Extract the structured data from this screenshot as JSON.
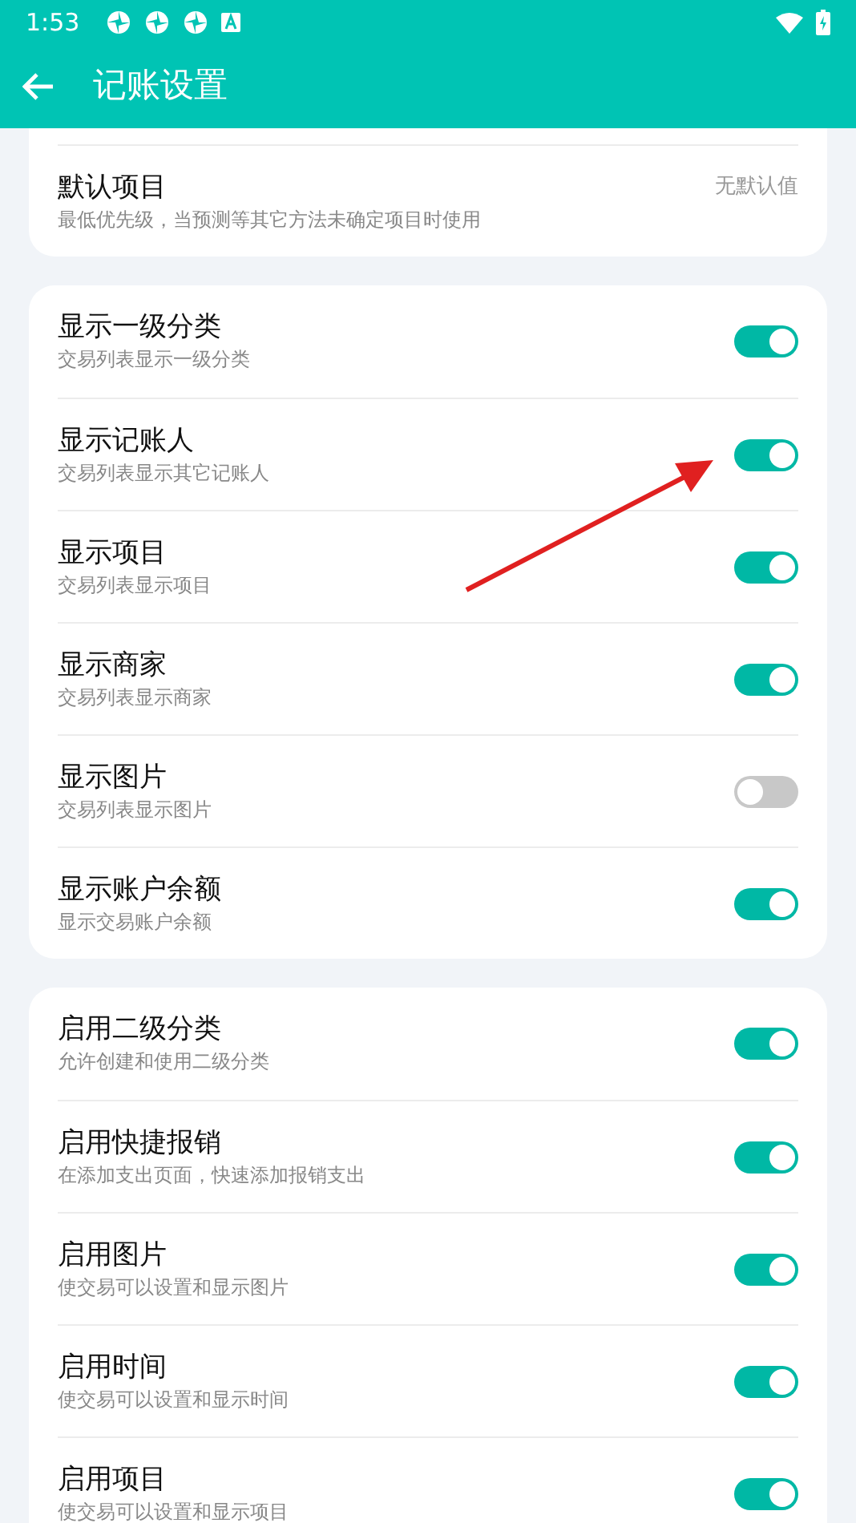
{
  "status_bar": {
    "time": "1:53"
  },
  "app_bar": {
    "title": "记账设置"
  },
  "sections": [
    {
      "partial": true,
      "rows": [
        {
          "kind": "value",
          "title": "默认项目",
          "subtitle": "最低优先级，当预测等其它方法未确定项目时使用",
          "value": "无默认值"
        }
      ]
    },
    {
      "rows": [
        {
          "kind": "switch",
          "title": "显示一级分类",
          "subtitle": "交易列表显示一级分类",
          "on": true
        },
        {
          "kind": "switch",
          "title": "显示记账人",
          "subtitle": "交易列表显示其它记账人",
          "on": true
        },
        {
          "kind": "switch",
          "title": "显示项目",
          "subtitle": "交易列表显示项目",
          "on": true
        },
        {
          "kind": "switch",
          "title": "显示商家",
          "subtitle": "交易列表显示商家",
          "on": true
        },
        {
          "kind": "switch",
          "title": "显示图片",
          "subtitle": "交易列表显示图片",
          "on": false
        },
        {
          "kind": "switch",
          "title": "显示账户余额",
          "subtitle": "显示交易账户余额",
          "on": true
        }
      ]
    },
    {
      "rows": [
        {
          "kind": "switch",
          "title": "启用二级分类",
          "subtitle": "允许创建和使用二级分类",
          "on": true
        },
        {
          "kind": "switch",
          "title": "启用快捷报销",
          "subtitle": "在添加支出页面，快速添加报销支出",
          "on": true
        },
        {
          "kind": "switch",
          "title": "启用图片",
          "subtitle": "使交易可以设置和显示图片",
          "on": true
        },
        {
          "kind": "switch",
          "title": "启用时间",
          "subtitle": "使交易可以设置和显示时间",
          "on": true
        },
        {
          "kind": "switch",
          "title": "启用项目",
          "subtitle": "使交易可以设置和显示项目",
          "on": true
        }
      ]
    }
  ]
}
